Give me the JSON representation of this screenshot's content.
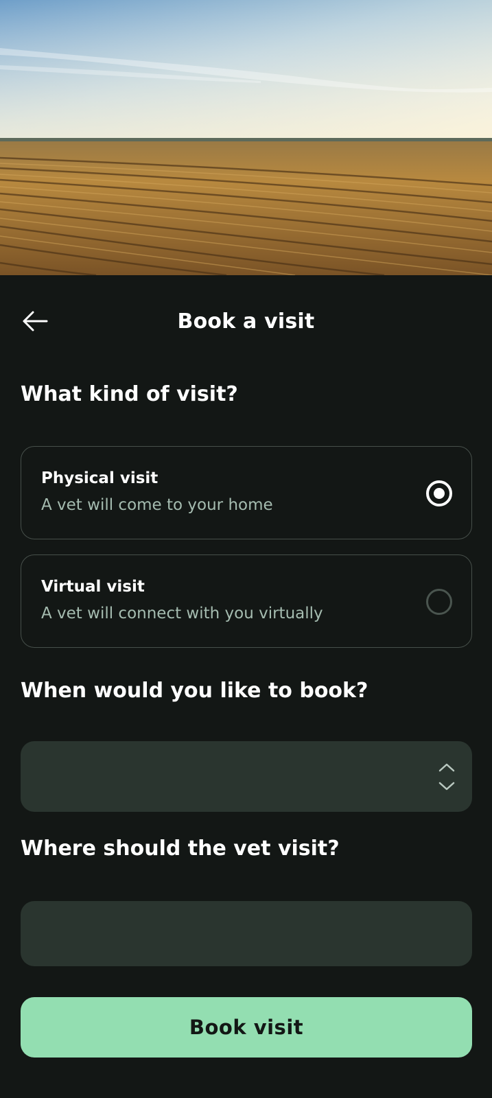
{
  "header": {
    "title": "Book a visit",
    "back_icon": "arrow-left-icon"
  },
  "visit_type": {
    "heading": "What kind of visit?",
    "options": [
      {
        "title": "Physical visit",
        "subtitle": "A vet will come to your home",
        "selected": true
      },
      {
        "title": "Virtual visit",
        "subtitle": "A vet will connect with you virtually",
        "selected": false
      }
    ]
  },
  "when": {
    "heading": "When would you like to book?",
    "value": "",
    "icon": "chevron-up-down-icon"
  },
  "where": {
    "heading": "Where should the vet visit?",
    "value": ""
  },
  "actions": {
    "book_label": "Book visit"
  },
  "colors": {
    "background": "#131715",
    "field": "#2a352f",
    "accent": "#93deb1",
    "muted_text": "#a5bcb0",
    "border": "#47504b"
  }
}
